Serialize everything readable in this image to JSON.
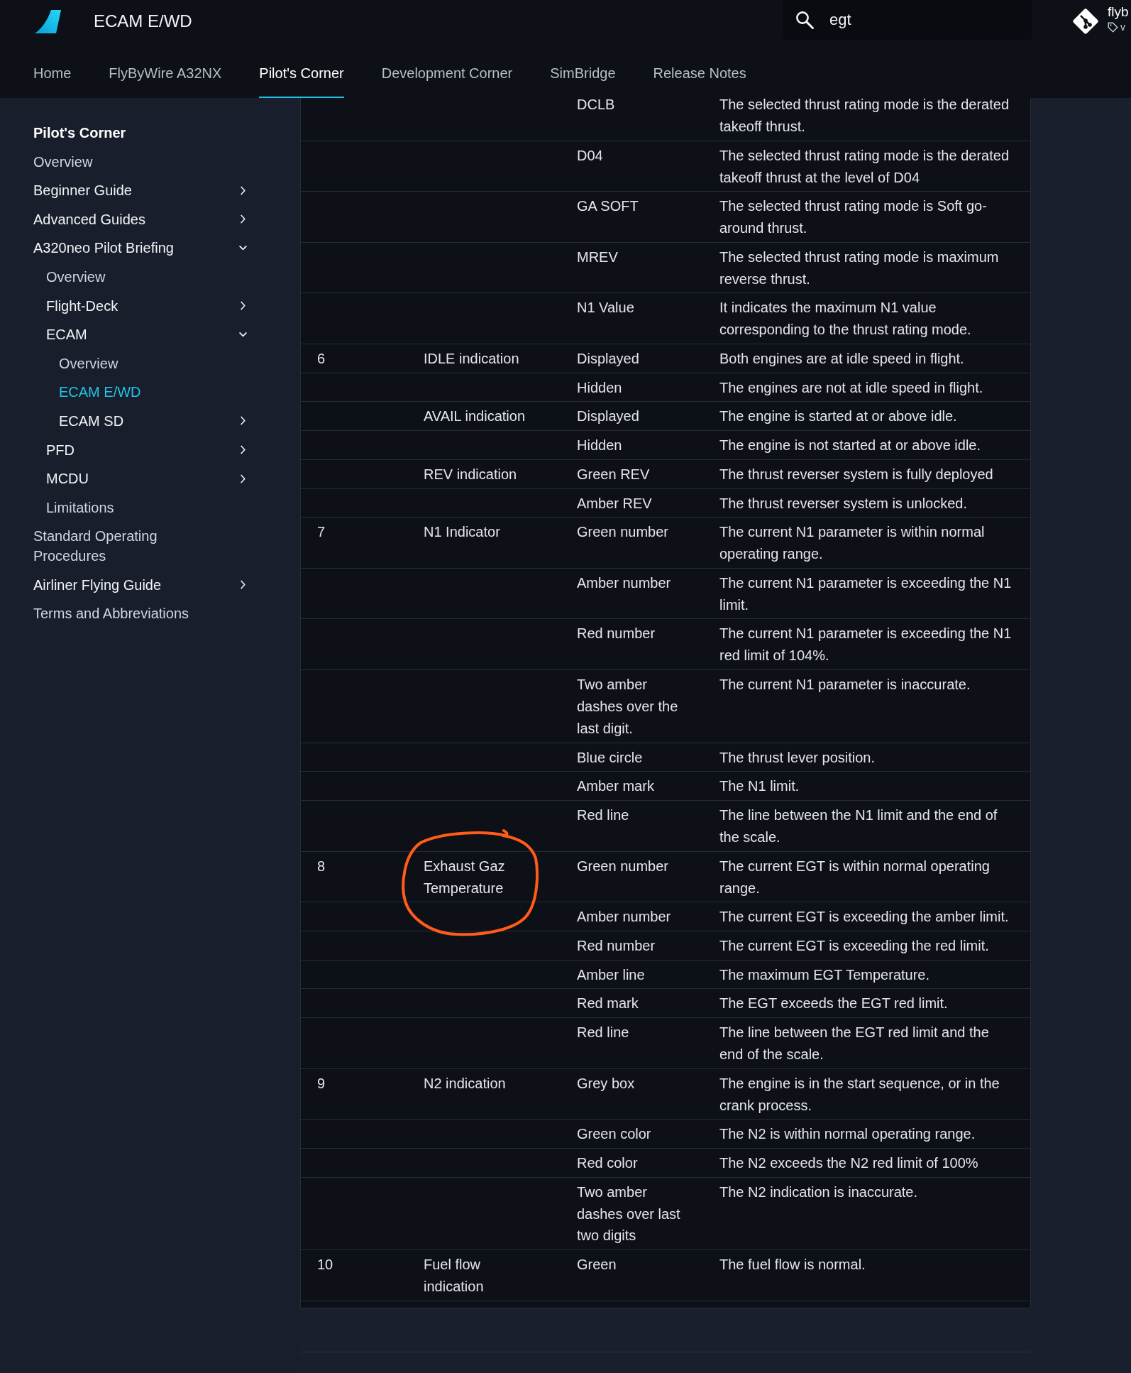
{
  "header": {
    "title": "ECAM E/WD",
    "search": {
      "value": "egt"
    },
    "repo": {
      "name": "flyb",
      "version": "v"
    }
  },
  "tabs": [
    {
      "label": "Home",
      "selected": false
    },
    {
      "label": "FlyByWire A32NX",
      "selected": false
    },
    {
      "label": "Pilot's Corner",
      "selected": true
    },
    {
      "label": "Development Corner",
      "selected": false
    },
    {
      "label": "SimBridge",
      "selected": false
    },
    {
      "label": "Release Notes",
      "selected": false
    }
  ],
  "sidebar": {
    "title": "Pilot's Corner",
    "items": [
      {
        "label": "Overview",
        "selected": false
      },
      {
        "label": "Beginner Guide",
        "selected": false,
        "expanded": false
      },
      {
        "label": "Advanced Guides",
        "selected": false,
        "expanded": false
      },
      {
        "label": "A320neo Pilot Briefing",
        "selected": false,
        "expanded": true,
        "children": [
          {
            "label": "Overview",
            "selected": false
          },
          {
            "label": "Flight-Deck",
            "selected": false,
            "expanded": false
          },
          {
            "label": "ECAM",
            "selected": false,
            "expanded": true,
            "children": [
              {
                "label": "Overview",
                "selected": false
              },
              {
                "label": "ECAM E/WD",
                "selected": true
              },
              {
                "label": "ECAM SD",
                "selected": false,
                "expanded": false
              }
            ]
          },
          {
            "label": "PFD",
            "selected": false,
            "expanded": false
          },
          {
            "label": "MCDU",
            "selected": false,
            "expanded": false
          },
          {
            "label": "Limitations",
            "selected": false
          }
        ]
      },
      {
        "label": "Standard Operating Procedures",
        "selected": false
      },
      {
        "label": "Airliner Flying Guide",
        "selected": false,
        "expanded": false
      },
      {
        "label": "Terms and Abbreviations",
        "selected": false
      }
    ]
  },
  "table": {
    "rows": [
      {
        "column_3": "DCLB",
        "column_4": "The selected thrust rating mode is the derated takeoff thrust.",
        "circled": false
      },
      {
        "column_3": "D04",
        "column_4": "The selected thrust rating mode is the derated takeoff thrust at the level of D04",
        "circled": false
      },
      {
        "column_3": "GA SOFT",
        "column_4": "The selected thrust rating mode is Soft go-around thrust.",
        "circled": false
      },
      {
        "column_3": "MREV",
        "column_4": "The selected thrust rating mode is maximum reverse thrust.",
        "circled": false
      },
      {
        "column_3": "N1 Value",
        "column_4": "It indicates the maximum N1 value corresponding to the thrust rating mode.",
        "circled": false
      },
      {
        "column_1": "6",
        "column_2": "IDLE indication",
        "column_3": "Displayed",
        "column_4": "Both engines are at idle speed in flight.",
        "circled": false
      },
      {
        "column_3": "Hidden",
        "column_4": "The engines are not at idle speed in flight.",
        "circled": false
      },
      {
        "column_2": "AVAIL indication",
        "column_3": "Displayed",
        "column_4": "The engine is started at or above idle.",
        "circled": false
      },
      {
        "column_3": "Hidden",
        "column_4": "The engine is not started at or above idle.",
        "circled": false
      },
      {
        "column_2": "REV indication",
        "column_3": "Green REV",
        "column_4": "The thrust reverser system is fully deployed",
        "circled": false
      },
      {
        "column_3": "Amber REV",
        "column_4": "The thrust reverser system is unlocked.",
        "circled": false
      },
      {
        "column_1": "7",
        "column_2": "N1 Indicator",
        "column_3": "Green number",
        "column_4": "The current N1 parameter is within normal operating range.",
        "circled": false
      },
      {
        "column_3": "Amber number",
        "column_4": "The current N1 parameter is exceeding the N1 limit.",
        "circled": false
      },
      {
        "column_3": "Red number",
        "column_4": "The current N1 parameter is exceeding the N1 red limit of 104%.",
        "circled": false
      },
      {
        "column_3": "Two amber dashes over the last digit.",
        "column_4": "The current N1 parameter is inaccurate.",
        "circled": false
      },
      {
        "column_3": "Blue circle",
        "column_4": "The thrust lever position.",
        "circled": false
      },
      {
        "column_3": "Amber mark",
        "column_4": "The N1 limit.",
        "circled": false
      },
      {
        "column_3": "Red line",
        "column_4": "The line between the N1 limit and the end of the scale.",
        "circled": false
      },
      {
        "column_1": "8",
        "column_2": "Exhaust Gaz Temperature",
        "column_3": "Green number",
        "column_4": "The current EGT is within normal operating range.",
        "circled": true
      },
      {
        "column_3": "Amber number",
        "column_4": "The current EGT is exceeding the amber limit.",
        "circled": false
      },
      {
        "column_3": "Red number",
        "column_4": "The current EGT is exceeding the red limit.",
        "circled": false
      },
      {
        "column_3": "Amber line",
        "column_4": "The maximum EGT Temperature.",
        "circled": false
      },
      {
        "column_3": "Red mark",
        "column_4": "The EGT exceeds the EGT red limit.",
        "circled": false
      },
      {
        "column_3": "Red line",
        "column_4": "The line between the EGT red limit and the end of the scale.",
        "circled": false
      },
      {
        "column_1": "9",
        "column_2": "N2 indication",
        "column_3": "Grey box",
        "column_4": "The engine is in the start sequence, or in the crank process.",
        "circled": false
      },
      {
        "column_3": "Green color",
        "column_4": "The N2 is within normal operating range.",
        "circled": false
      },
      {
        "column_3": "Red color",
        "column_4": "The N2 exceeds the N2 red limit of 100%",
        "circled": false
      },
      {
        "column_3": "Two amber dashes over last two digits",
        "column_4": "The N2 indication is inaccurate.",
        "circled": false
      },
      {
        "column_1": "10",
        "column_2": "Fuel flow indication",
        "column_3": "Green",
        "column_4": "The fuel flow is normal.",
        "circled": false
      }
    ]
  }
}
